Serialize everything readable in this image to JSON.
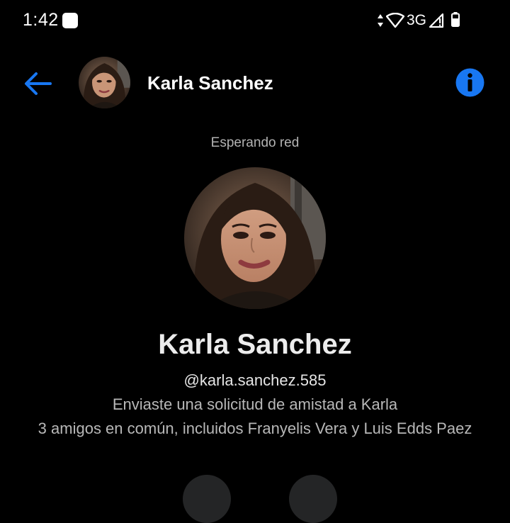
{
  "status_bar": {
    "time": "1:42",
    "network": "3G",
    "icons": [
      "notification-icon",
      "data-arrows-icon",
      "wifi-icon",
      "signal-icon",
      "battery-icon"
    ]
  },
  "header": {
    "contact_name": "Karla Sanchez",
    "back_icon": "back-arrow-icon",
    "info_icon": "info-icon",
    "accent_color": "#1877f2"
  },
  "connection_status": "Esperando red",
  "profile": {
    "name": "Karla Sanchez",
    "handle": "@karla.sanchez.585",
    "friend_request": "Enviaste una solicitud de amistad a Karla",
    "mutual_friends": "3 amigos en común, incluidos Franyelis Vera y Luis Edds Paez"
  },
  "colors": {
    "background": "#000000",
    "secondary_text": "#b8b8b8",
    "action_button": "#242526"
  }
}
